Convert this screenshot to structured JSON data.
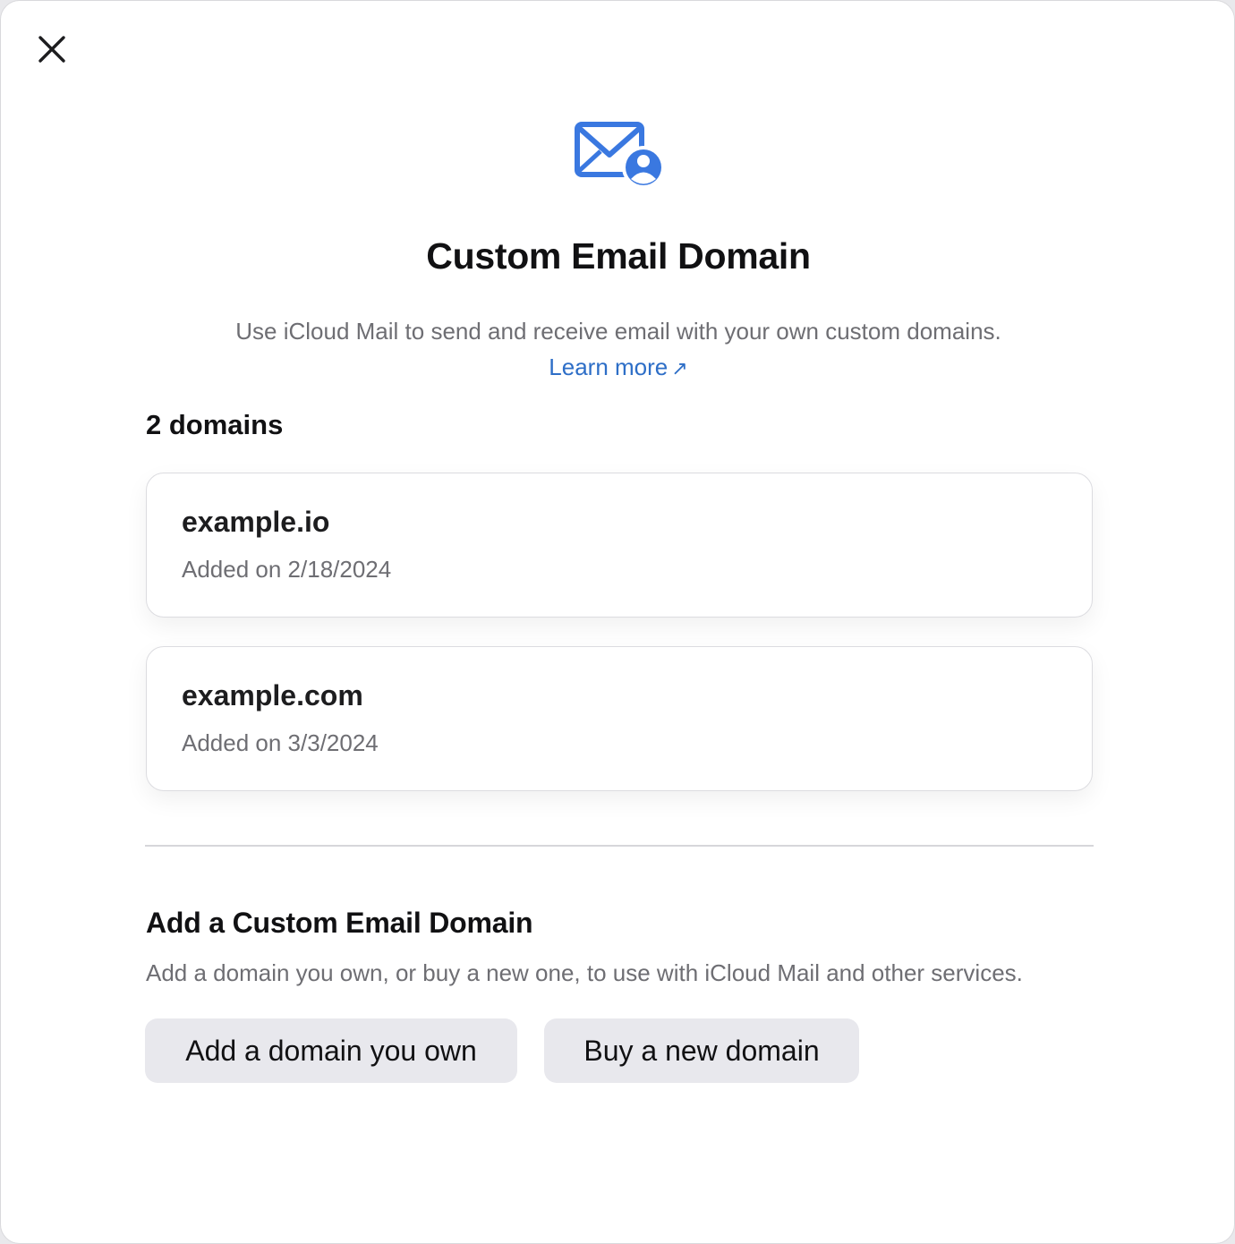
{
  "dialog": {
    "close_icon": "close-icon",
    "hero_icon": "mail-person-icon",
    "accent_color": "#3a78e0",
    "title": "Custom Email Domain",
    "subtitle": "Use iCloud Mail to send and receive email with your own custom domains.",
    "learn_more": "Learn more",
    "learn_more_arrow": "↗"
  },
  "domains": {
    "count_label": "2 domains",
    "items": [
      {
        "name": "example.io",
        "added": "Added on 2/18/2024"
      },
      {
        "name": "example.com",
        "added": "Added on 3/3/2024"
      }
    ]
  },
  "add_section": {
    "title": "Add a Custom Email Domain",
    "description": "Add a domain you own, or buy a new one, to use with iCloud Mail and other services.",
    "add_own_label": "Add a domain you own",
    "buy_new_label": "Buy a new domain"
  }
}
